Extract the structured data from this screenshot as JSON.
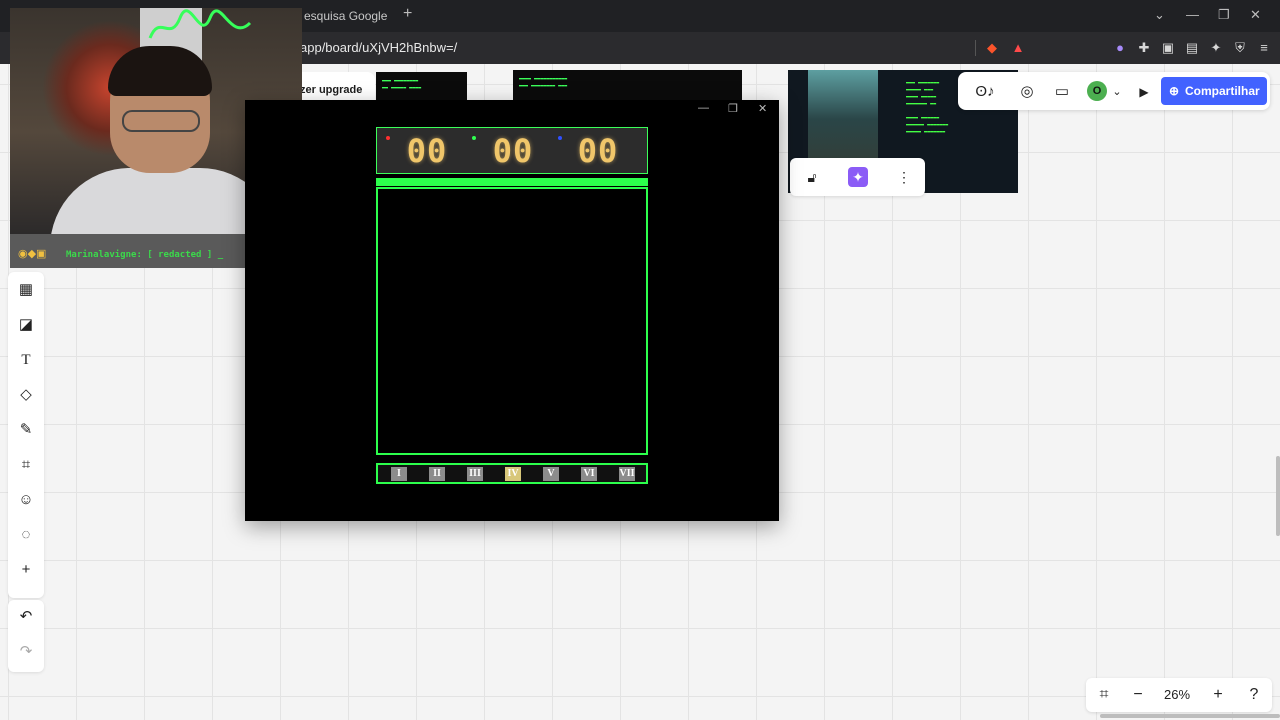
{
  "browser": {
    "tab_title": "esquisa Google",
    "url": "app/board/uXjVH2hBnbw=/",
    "win_minimize": "—",
    "win_restore": "❐",
    "win_close": "✕"
  },
  "board": {
    "upgrade_label": "zer upgrade",
    "share_label": "Compartilhar",
    "avatar_initial": "O",
    "zoom_level": "26%"
  },
  "chat": {
    "message": "Marinalavigne: [ redacted ] _"
  },
  "game": {
    "scores": [
      "00",
      "00",
      "00"
    ],
    "levels": [
      "I",
      "II",
      "III",
      "IV",
      "V",
      "VI",
      "VII"
    ],
    "active_level": "IV"
  }
}
